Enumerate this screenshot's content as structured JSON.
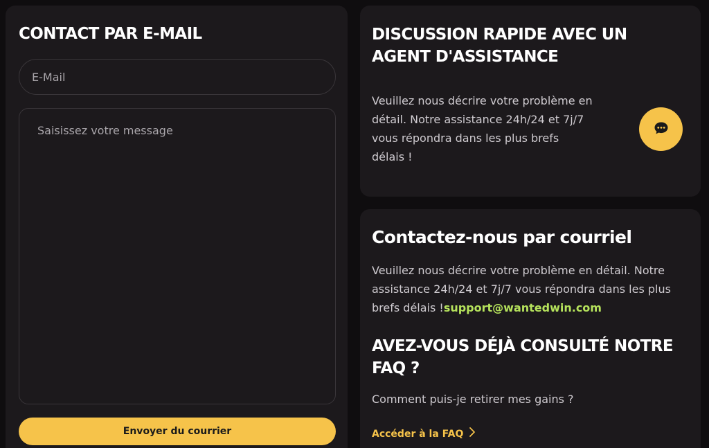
{
  "email_form": {
    "title": "CONTACT PAR E-MAIL",
    "email_placeholder": "E-Mail",
    "message_placeholder": "Saisissez votre message",
    "send_label": "Envoyer du courrier"
  },
  "chat": {
    "title": "DISCUSSION RAPIDE AVEC UN AGENT D'ASSISTANCE",
    "description": "Veuillez nous décrire votre problème en détail. Notre assistance 24h/24 et 7j/7 vous répondra dans les plus brefs délais !",
    "icon": "chat-bubble-icon"
  },
  "mail": {
    "title": "Contactez-nous par courriel",
    "description": "Veuillez nous décrire votre problème en détail. Notre assistance 24h/24 et 7j/7 vous répondra dans les plus brefs délais !",
    "email": "support@wantedwin.com"
  },
  "faq": {
    "title": "AVEZ-VOUS DÉJÀ CONSULTÉ NOTRE FAQ ?",
    "question": "Comment puis-je retirer mes gains ?",
    "link_label": "Accéder à la FAQ",
    "icon": "chevron-right-icon"
  },
  "colors": {
    "background": "#0f0d0f",
    "card": "#1c191c",
    "accent": "#f6c34a",
    "link_green": "#b6e35c",
    "body_text": "#cfcbd0"
  }
}
